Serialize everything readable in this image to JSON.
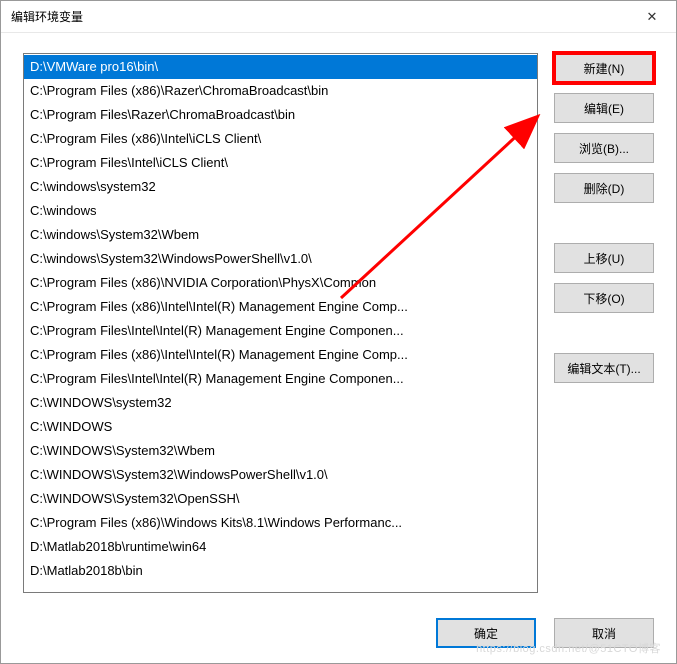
{
  "window": {
    "title": "编辑环境变量",
    "close_label": "✕"
  },
  "list": {
    "items": [
      "D:\\VMWare pro16\\bin\\",
      "C:\\Program Files (x86)\\Razer\\ChromaBroadcast\\bin",
      "C:\\Program Files\\Razer\\ChromaBroadcast\\bin",
      "C:\\Program Files (x86)\\Intel\\iCLS Client\\",
      "C:\\Program Files\\Intel\\iCLS Client\\",
      "C:\\windows\\system32",
      "C:\\windows",
      "C:\\windows\\System32\\Wbem",
      "C:\\windows\\System32\\WindowsPowerShell\\v1.0\\",
      "C:\\Program Files (x86)\\NVIDIA Corporation\\PhysX\\Common",
      "C:\\Program Files (x86)\\Intel\\Intel(R) Management Engine Comp...",
      "C:\\Program Files\\Intel\\Intel(R) Management Engine Componen...",
      "C:\\Program Files (x86)\\Intel\\Intel(R) Management Engine Comp...",
      "C:\\Program Files\\Intel\\Intel(R) Management Engine Componen...",
      "C:\\WINDOWS\\system32",
      "C:\\WINDOWS",
      "C:\\WINDOWS\\System32\\Wbem",
      "C:\\WINDOWS\\System32\\WindowsPowerShell\\v1.0\\",
      "C:\\WINDOWS\\System32\\OpenSSH\\",
      "C:\\Program Files (x86)\\Windows Kits\\8.1\\Windows Performanc...",
      "D:\\Matlab2018b\\runtime\\win64",
      "D:\\Matlab2018b\\bin"
    ],
    "selected_index": 0
  },
  "buttons": {
    "new": "新建(N)",
    "edit": "编辑(E)",
    "browse": "浏览(B)...",
    "delete": "删除(D)",
    "move_up": "上移(U)",
    "move_down": "下移(O)",
    "edit_text": "编辑文本(T)...",
    "ok": "确定",
    "cancel": "取消"
  },
  "watermark": "https://blog.csdn.net/@51CTO博客"
}
